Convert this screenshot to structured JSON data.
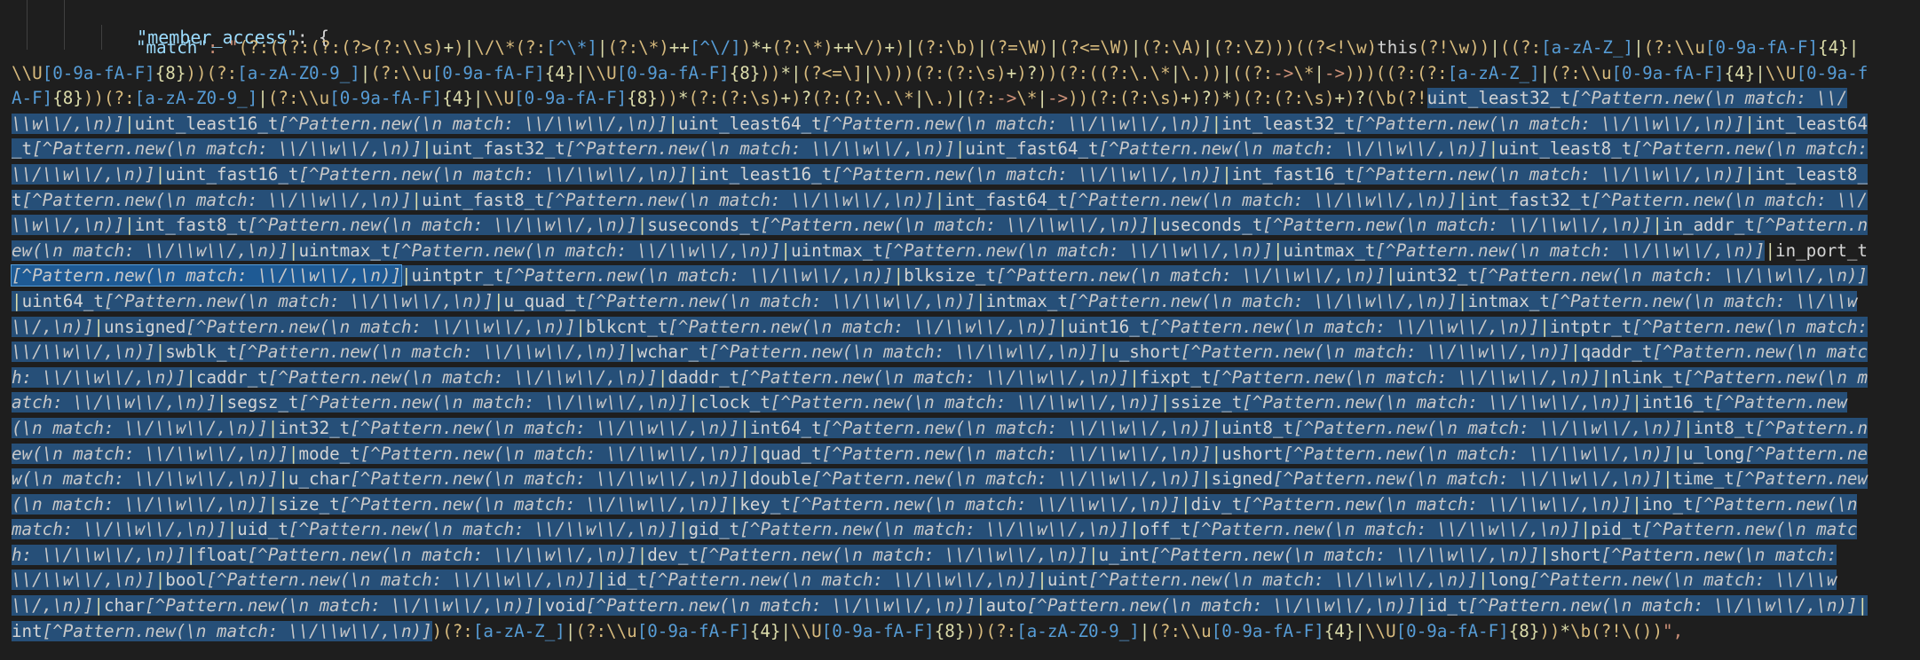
{
  "editor": {
    "header_key_1": "\"member_access\"",
    "header_punct_1": ": {",
    "header_key_2": "\"match\"",
    "header_punct_2": ": \""
  },
  "colors": {
    "background": "#1e1e1e",
    "key": "#9cdcfe",
    "string": "#ce9178",
    "regex_group": "#d7ba7d",
    "regex_class": "#569cd6",
    "regex_escape": "#d7ba7d",
    "regex_op": "#dcdcaa",
    "type": "#c586c0",
    "italic": "#c8c8c8",
    "plain": "#d4d4d4",
    "selection": "#264f78",
    "selection_strong": "#1e5a94"
  },
  "regex_prefix": "(?:((?:(?:(?>(?:\\\\s)+)|\\/\\*(?:[^\\*]|(?:\\*)++[^\\/])*+(?:\\*)++\\/)+)|(?:\\b)|(?=\\W)|(?<=\\W)|(?:\\A)|(?:\\Z)))((?<!\\w)this(?!\\w))|((?:[a-zA-Z_]|(?:\\\\u[0-9a-fA-F]{4}|\\\\U[0-9a-fA-F]{8}))(?:[a-zA-Z0-9_]|(?:\\\\u[0-9a-fA-F]{4}|\\\\U[0-9a-fA-F]{8}))*|(?<=\\]|\\)))(?:(?:\\s)+)?))(?:((?:\\.\\*|\\.))|((?:->\\*|->)))((?:(?:[a-zA-Z_]|(?:\\\\u[0-9a-fA-F]{4}|\\\\U[0-9a-fA-F]{8}))(?:[a-zA-Z0-9_]|(?:\\\\u[0-9a-fA-F]{4}|\\\\U[0-9a-fA-F]{8}))*(?:(?:\\s)+)?(?:(?:\\.\\*|\\.)|(?:->\\*|->))(?:(?:\\s)+)?)*)(?:(?:\\s)+)?(\\b(?!",
  "pattern_fragment": "[^Pattern.new(\\n  match: \\\\/\\\\w\\\\/,\\n)]",
  "types": [
    "uint_least32_t",
    "uint_least16_t",
    "uint_least64_t",
    "int_least32_t",
    "int_least64_t",
    "uint_fast32_t",
    "uint_fast64_t",
    "uint_least8_t",
    "uint_fast16_t",
    "int_least16_t",
    "int_fast16_t",
    "int_least8_t",
    "uint_fast8_t",
    "int_fast64_t",
    "int_fast32_t",
    "int_fast8_t",
    "suseconds_t",
    "useconds_t",
    "in_addr_t",
    "uintmax_t",
    "uintmax_t",
    "uintmax_t",
    "in_port_t",
    "uintptr_t",
    "blksize_t",
    "uint32_t",
    "uint64_t",
    "u_quad_t",
    "intmax_t",
    "intmax_t",
    "unsigned",
    "blkcnt_t",
    "uint16_t",
    "intptr_t",
    "swblk_t",
    "wchar_t",
    "u_short",
    "qaddr_t",
    "caddr_t",
    "daddr_t",
    "fixpt_t",
    "nlink_t",
    "segsz_t",
    "clock_t",
    "ssize_t",
    "int16_t",
    "int32_t",
    "int64_t",
    "uint8_t",
    "int8_t",
    "mode_t",
    "quad_t",
    "ushort",
    "u_long",
    "u_char",
    "double",
    "signed",
    "time_t",
    "size_t",
    "key_t",
    "div_t",
    "ino_t",
    "uid_t",
    "gid_t",
    "off_t",
    "pid_t",
    "float",
    "dev_t",
    "u_int",
    "short",
    "bool",
    "id_t",
    "uint",
    "long",
    "char",
    "void",
    "auto",
    "id_t",
    "int"
  ],
  "regex_suffix": ")(?:[a-zA-Z_]|(?:\\\\u[0-9a-fA-F]{4}|\\\\U[0-9a-fA-F]{8}))(?:[a-zA-Z0-9_]|(?:\\\\u[0-9a-fA-F]{4}|\\\\U[0-9a-fA-F]{8}))*\\b(?!\\())\","
}
